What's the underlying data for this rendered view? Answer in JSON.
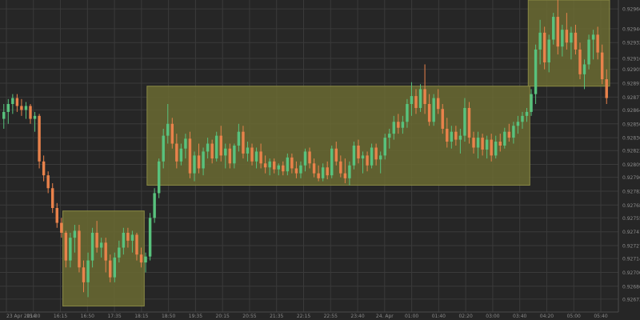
{
  "chart_data": {
    "type": "candlestick",
    "title": "",
    "xlabel": "",
    "ylabel": "",
    "ylim": [
      0.9266,
      0.92975
    ],
    "grid": true,
    "colors": {
      "background": "#262626",
      "grid": "#3a3a3a",
      "up": "#58c27d",
      "down": "#e9824b",
      "zone_fill": "#6b6b32",
      "zone_border": "#8a8a45",
      "axis_text": "#8a8a8a"
    },
    "y_ticks": [
      "0.92966",
      "0.92946",
      "0.92932",
      "0.92916",
      "0.92905",
      "0.92891",
      "0.92877",
      "0.92864",
      "0.92850",
      "0.92836",
      "0.92823",
      "0.92809",
      "0.92796",
      "0.92782",
      "0.92768",
      "0.92755",
      "0.92741",
      "0.92727",
      "0.92714",
      "0.92700",
      "0.92686",
      "0.92673"
    ],
    "x_ticks": [
      "23 Apr 2014",
      "15:30",
      "16:15",
      "16:50",
      "17:35",
      "18:15",
      "18:50",
      "19:35",
      "20:15",
      "20:55",
      "21:35",
      "22:15",
      "22:55",
      "23:40",
      "24. Apr",
      "01:00",
      "01:40",
      "02:20",
      "03:00",
      "03:40",
      "04:20",
      "05:00",
      "05:40"
    ],
    "zones": [
      {
        "y_low": 0.92666,
        "y_high": 0.92762
      },
      {
        "y_low": 0.92788,
        "y_high": 0.92888
      },
      {
        "y_low": 0.92888,
        "y_high": 0.92975
      }
    ],
    "candles": [
      {
        "o": 0.92855,
        "h": 0.9287,
        "l": 0.92845,
        "c": 0.92862
      },
      {
        "o": 0.92862,
        "h": 0.92875,
        "l": 0.9285,
        "c": 0.9287
      },
      {
        "o": 0.9287,
        "h": 0.9288,
        "l": 0.9286,
        "c": 0.92876
      },
      {
        "o": 0.92876,
        "h": 0.9288,
        "l": 0.92862,
        "c": 0.92868
      },
      {
        "o": 0.92868,
        "h": 0.92875,
        "l": 0.92858,
        "c": 0.92864
      },
      {
        "o": 0.92864,
        "h": 0.92872,
        "l": 0.92855,
        "c": 0.92868
      },
      {
        "o": 0.92868,
        "h": 0.9287,
        "l": 0.9285,
        "c": 0.92855
      },
      {
        "o": 0.92855,
        "h": 0.92862,
        "l": 0.92842,
        "c": 0.92858
      },
      {
        "o": 0.92858,
        "h": 0.9286,
        "l": 0.92805,
        "c": 0.92812
      },
      {
        "o": 0.92812,
        "h": 0.92818,
        "l": 0.92792,
        "c": 0.92798
      },
      {
        "o": 0.92798,
        "h": 0.92802,
        "l": 0.9278,
        "c": 0.92785
      },
      {
        "o": 0.92785,
        "h": 0.9279,
        "l": 0.9276,
        "c": 0.92765
      },
      {
        "o": 0.92765,
        "h": 0.9277,
        "l": 0.92745,
        "c": 0.9275
      },
      {
        "o": 0.9275,
        "h": 0.92755,
        "l": 0.92735,
        "c": 0.9274
      },
      {
        "o": 0.9274,
        "h": 0.92742,
        "l": 0.92705,
        "c": 0.92712
      },
      {
        "o": 0.92712,
        "h": 0.9274,
        "l": 0.92705,
        "c": 0.92735
      },
      {
        "o": 0.92735,
        "h": 0.92748,
        "l": 0.9272,
        "c": 0.92742
      },
      {
        "o": 0.92742,
        "h": 0.92748,
        "l": 0.927,
        "c": 0.92705
      },
      {
        "o": 0.92705,
        "h": 0.92712,
        "l": 0.9268,
        "c": 0.9269
      },
      {
        "o": 0.9269,
        "h": 0.9272,
        "l": 0.92675,
        "c": 0.92712
      },
      {
        "o": 0.92712,
        "h": 0.92745,
        "l": 0.92705,
        "c": 0.9274
      },
      {
        "o": 0.9274,
        "h": 0.92752,
        "l": 0.9272,
        "c": 0.92725
      },
      {
        "o": 0.92725,
        "h": 0.92735,
        "l": 0.92715,
        "c": 0.9273
      },
      {
        "o": 0.9273,
        "h": 0.92735,
        "l": 0.927,
        "c": 0.92712
      },
      {
        "o": 0.92712,
        "h": 0.92718,
        "l": 0.9269,
        "c": 0.92695
      },
      {
        "o": 0.92695,
        "h": 0.9272,
        "l": 0.9269,
        "c": 0.92715
      },
      {
        "o": 0.92715,
        "h": 0.92732,
        "l": 0.9271,
        "c": 0.92725
      },
      {
        "o": 0.92725,
        "h": 0.92745,
        "l": 0.92718,
        "c": 0.9274
      },
      {
        "o": 0.9274,
        "h": 0.92745,
        "l": 0.92725,
        "c": 0.92732
      },
      {
        "o": 0.92732,
        "h": 0.92742,
        "l": 0.9272,
        "c": 0.92738
      },
      {
        "o": 0.92738,
        "h": 0.9274,
        "l": 0.92712,
        "c": 0.92718
      },
      {
        "o": 0.92718,
        "h": 0.92725,
        "l": 0.92705,
        "c": 0.9271
      },
      {
        "o": 0.9271,
        "h": 0.9272,
        "l": 0.927,
        "c": 0.92716
      },
      {
        "o": 0.92716,
        "h": 0.9276,
        "l": 0.92712,
        "c": 0.92755
      },
      {
        "o": 0.92755,
        "h": 0.92785,
        "l": 0.9275,
        "c": 0.9278
      },
      {
        "o": 0.9278,
        "h": 0.92815,
        "l": 0.92775,
        "c": 0.92812
      },
      {
        "o": 0.92812,
        "h": 0.92845,
        "l": 0.92805,
        "c": 0.92838
      },
      {
        "o": 0.92838,
        "h": 0.9287,
        "l": 0.9283,
        "c": 0.9285
      },
      {
        "o": 0.9285,
        "h": 0.92856,
        "l": 0.92825,
        "c": 0.9283
      },
      {
        "o": 0.9283,
        "h": 0.9284,
        "l": 0.92805,
        "c": 0.92812
      },
      {
        "o": 0.92812,
        "h": 0.9283,
        "l": 0.92808,
        "c": 0.92825
      },
      {
        "o": 0.92825,
        "h": 0.9284,
        "l": 0.92815,
        "c": 0.92835
      },
      {
        "o": 0.92835,
        "h": 0.92842,
        "l": 0.92795,
        "c": 0.928
      },
      {
        "o": 0.928,
        "h": 0.92822,
        "l": 0.92792,
        "c": 0.92818
      },
      {
        "o": 0.92818,
        "h": 0.9283,
        "l": 0.928,
        "c": 0.92805
      },
      {
        "o": 0.92805,
        "h": 0.92826,
        "l": 0.92798,
        "c": 0.92822
      },
      {
        "o": 0.92822,
        "h": 0.92836,
        "l": 0.92815,
        "c": 0.9283
      },
      {
        "o": 0.9283,
        "h": 0.92834,
        "l": 0.9281,
        "c": 0.92815
      },
      {
        "o": 0.92815,
        "h": 0.92842,
        "l": 0.92812,
        "c": 0.92838
      },
      {
        "o": 0.92838,
        "h": 0.92848,
        "l": 0.92812,
        "c": 0.92818
      },
      {
        "o": 0.92818,
        "h": 0.9283,
        "l": 0.92805,
        "c": 0.92825
      },
      {
        "o": 0.92825,
        "h": 0.9283,
        "l": 0.92805,
        "c": 0.9281
      },
      {
        "o": 0.9281,
        "h": 0.9283,
        "l": 0.92805,
        "c": 0.92828
      },
      {
        "o": 0.92828,
        "h": 0.9285,
        "l": 0.92822,
        "c": 0.92842
      },
      {
        "o": 0.92842,
        "h": 0.92848,
        "l": 0.92815,
        "c": 0.9282
      },
      {
        "o": 0.9282,
        "h": 0.92832,
        "l": 0.92812,
        "c": 0.92826
      },
      {
        "o": 0.92826,
        "h": 0.9283,
        "l": 0.92808,
        "c": 0.92812
      },
      {
        "o": 0.92812,
        "h": 0.92826,
        "l": 0.92805,
        "c": 0.92822
      },
      {
        "o": 0.92822,
        "h": 0.9283,
        "l": 0.92805,
        "c": 0.9281
      },
      {
        "o": 0.9281,
        "h": 0.92818,
        "l": 0.928,
        "c": 0.92806
      },
      {
        "o": 0.92806,
        "h": 0.92815,
        "l": 0.92798,
        "c": 0.92812
      },
      {
        "o": 0.92812,
        "h": 0.92815,
        "l": 0.928,
        "c": 0.92804
      },
      {
        "o": 0.92804,
        "h": 0.9281,
        "l": 0.92798,
        "c": 0.92808
      },
      {
        "o": 0.92808,
        "h": 0.92812,
        "l": 0.92798,
        "c": 0.92802
      },
      {
        "o": 0.92802,
        "h": 0.9282,
        "l": 0.92798,
        "c": 0.92816
      },
      {
        "o": 0.92816,
        "h": 0.9282,
        "l": 0.928,
        "c": 0.92805
      },
      {
        "o": 0.92805,
        "h": 0.92812,
        "l": 0.92795,
        "c": 0.928
      },
      {
        "o": 0.928,
        "h": 0.92812,
        "l": 0.92795,
        "c": 0.92808
      },
      {
        "o": 0.92808,
        "h": 0.92825,
        "l": 0.92802,
        "c": 0.92822
      },
      {
        "o": 0.92822,
        "h": 0.92826,
        "l": 0.92805,
        "c": 0.9281
      },
      {
        "o": 0.9281,
        "h": 0.92815,
        "l": 0.92796,
        "c": 0.928
      },
      {
        "o": 0.928,
        "h": 0.92808,
        "l": 0.92792,
        "c": 0.92795
      },
      {
        "o": 0.92795,
        "h": 0.9281,
        "l": 0.92792,
        "c": 0.92806
      },
      {
        "o": 0.92806,
        "h": 0.92812,
        "l": 0.92794,
        "c": 0.92798
      },
      {
        "o": 0.92798,
        "h": 0.92828,
        "l": 0.92795,
        "c": 0.92825
      },
      {
        "o": 0.92825,
        "h": 0.92832,
        "l": 0.92808,
        "c": 0.92812
      },
      {
        "o": 0.92812,
        "h": 0.92818,
        "l": 0.92796,
        "c": 0.928
      },
      {
        "o": 0.928,
        "h": 0.92815,
        "l": 0.9279,
        "c": 0.92795
      },
      {
        "o": 0.92795,
        "h": 0.92812,
        "l": 0.92788,
        "c": 0.92808
      },
      {
        "o": 0.92808,
        "h": 0.92832,
        "l": 0.92804,
        "c": 0.92828
      },
      {
        "o": 0.92828,
        "h": 0.92834,
        "l": 0.9281,
        "c": 0.92815
      },
      {
        "o": 0.92815,
        "h": 0.92822,
        "l": 0.928,
        "c": 0.92818
      },
      {
        "o": 0.92818,
        "h": 0.92822,
        "l": 0.92802,
        "c": 0.92808
      },
      {
        "o": 0.92808,
        "h": 0.9283,
        "l": 0.92805,
        "c": 0.92826
      },
      {
        "o": 0.92826,
        "h": 0.9283,
        "l": 0.92808,
        "c": 0.92814
      },
      {
        "o": 0.92814,
        "h": 0.92822,
        "l": 0.928,
        "c": 0.92818
      },
      {
        "o": 0.92818,
        "h": 0.9284,
        "l": 0.92814,
        "c": 0.92836
      },
      {
        "o": 0.92836,
        "h": 0.92845,
        "l": 0.92825,
        "c": 0.9284
      },
      {
        "o": 0.9284,
        "h": 0.92858,
        "l": 0.92834,
        "c": 0.92852
      },
      {
        "o": 0.92852,
        "h": 0.9286,
        "l": 0.9284,
        "c": 0.92846
      },
      {
        "o": 0.92846,
        "h": 0.92858,
        "l": 0.9284,
        "c": 0.92852
      },
      {
        "o": 0.92852,
        "h": 0.92875,
        "l": 0.92846,
        "c": 0.9287
      },
      {
        "o": 0.9287,
        "h": 0.92892,
        "l": 0.92858,
        "c": 0.92878
      },
      {
        "o": 0.92878,
        "h": 0.92885,
        "l": 0.9286,
        "c": 0.92866
      },
      {
        "o": 0.92866,
        "h": 0.9289,
        "l": 0.92862,
        "c": 0.92885
      },
      {
        "o": 0.92885,
        "h": 0.9291,
        "l": 0.9286,
        "c": 0.9287
      },
      {
        "o": 0.9287,
        "h": 0.9288,
        "l": 0.92848,
        "c": 0.92852
      },
      {
        "o": 0.92852,
        "h": 0.9288,
        "l": 0.92848,
        "c": 0.92876
      },
      {
        "o": 0.92876,
        "h": 0.92885,
        "l": 0.9286,
        "c": 0.92865
      },
      {
        "o": 0.92865,
        "h": 0.9287,
        "l": 0.9284,
        "c": 0.92845
      },
      {
        "o": 0.92845,
        "h": 0.92856,
        "l": 0.92826,
        "c": 0.92832
      },
      {
        "o": 0.92832,
        "h": 0.92848,
        "l": 0.92825,
        "c": 0.92842
      },
      {
        "o": 0.92842,
        "h": 0.92848,
        "l": 0.92828,
        "c": 0.92834
      },
      {
        "o": 0.92834,
        "h": 0.92845,
        "l": 0.9282,
        "c": 0.92838
      },
      {
        "o": 0.92838,
        "h": 0.92876,
        "l": 0.92832,
        "c": 0.92866
      },
      {
        "o": 0.92866,
        "h": 0.92872,
        "l": 0.9283,
        "c": 0.92836
      },
      {
        "o": 0.92836,
        "h": 0.92842,
        "l": 0.9282,
        "c": 0.92826
      },
      {
        "o": 0.92826,
        "h": 0.92842,
        "l": 0.92815,
        "c": 0.92836
      },
      {
        "o": 0.92836,
        "h": 0.9284,
        "l": 0.92818,
        "c": 0.92824
      },
      {
        "o": 0.92824,
        "h": 0.92838,
        "l": 0.92815,
        "c": 0.92834
      },
      {
        "o": 0.92834,
        "h": 0.9284,
        "l": 0.92812,
        "c": 0.92818
      },
      {
        "o": 0.92818,
        "h": 0.92838,
        "l": 0.92815,
        "c": 0.92832
      },
      {
        "o": 0.92832,
        "h": 0.9284,
        "l": 0.92822,
        "c": 0.92828
      },
      {
        "o": 0.92828,
        "h": 0.92846,
        "l": 0.92825,
        "c": 0.92842
      },
      {
        "o": 0.92842,
        "h": 0.9285,
        "l": 0.92832,
        "c": 0.92836
      },
      {
        "o": 0.92836,
        "h": 0.92852,
        "l": 0.9283,
        "c": 0.92848
      },
      {
        "o": 0.92848,
        "h": 0.92858,
        "l": 0.9284,
        "c": 0.92852
      },
      {
        "o": 0.92852,
        "h": 0.92862,
        "l": 0.92845,
        "c": 0.92858
      },
      {
        "o": 0.92858,
        "h": 0.92866,
        "l": 0.92852,
        "c": 0.92862
      },
      {
        "o": 0.92862,
        "h": 0.92885,
        "l": 0.92858,
        "c": 0.9288
      },
      {
        "o": 0.9288,
        "h": 0.9293,
        "l": 0.9287,
        "c": 0.92925
      },
      {
        "o": 0.92925,
        "h": 0.92955,
        "l": 0.9291,
        "c": 0.92942
      },
      {
        "o": 0.92942,
        "h": 0.92948,
        "l": 0.92905,
        "c": 0.92912
      },
      {
        "o": 0.92912,
        "h": 0.9294,
        "l": 0.92902,
        "c": 0.92935
      },
      {
        "o": 0.92935,
        "h": 0.92962,
        "l": 0.9293,
        "c": 0.92958
      },
      {
        "o": 0.92958,
        "h": 0.92975,
        "l": 0.9292,
        "c": 0.92928
      },
      {
        "o": 0.92928,
        "h": 0.9295,
        "l": 0.92918,
        "c": 0.92945
      },
      {
        "o": 0.92945,
        "h": 0.92962,
        "l": 0.92925,
        "c": 0.92932
      },
      {
        "o": 0.92932,
        "h": 0.92948,
        "l": 0.92915,
        "c": 0.92942
      },
      {
        "o": 0.92942,
        "h": 0.9295,
        "l": 0.9292,
        "c": 0.92925
      },
      {
        "o": 0.92925,
        "h": 0.92932,
        "l": 0.92895,
        "c": 0.929
      },
      {
        "o": 0.929,
        "h": 0.92915,
        "l": 0.92885,
        "c": 0.9291
      },
      {
        "o": 0.9291,
        "h": 0.9294,
        "l": 0.92905,
        "c": 0.92935
      },
      {
        "o": 0.92935,
        "h": 0.92945,
        "l": 0.92915,
        "c": 0.9294
      },
      {
        "o": 0.9294,
        "h": 0.92948,
        "l": 0.92915,
        "c": 0.92922
      },
      {
        "o": 0.92922,
        "h": 0.9293,
        "l": 0.9289,
        "c": 0.92895
      },
      {
        "o": 0.92895,
        "h": 0.92905,
        "l": 0.9287,
        "c": 0.92876
      }
    ]
  }
}
